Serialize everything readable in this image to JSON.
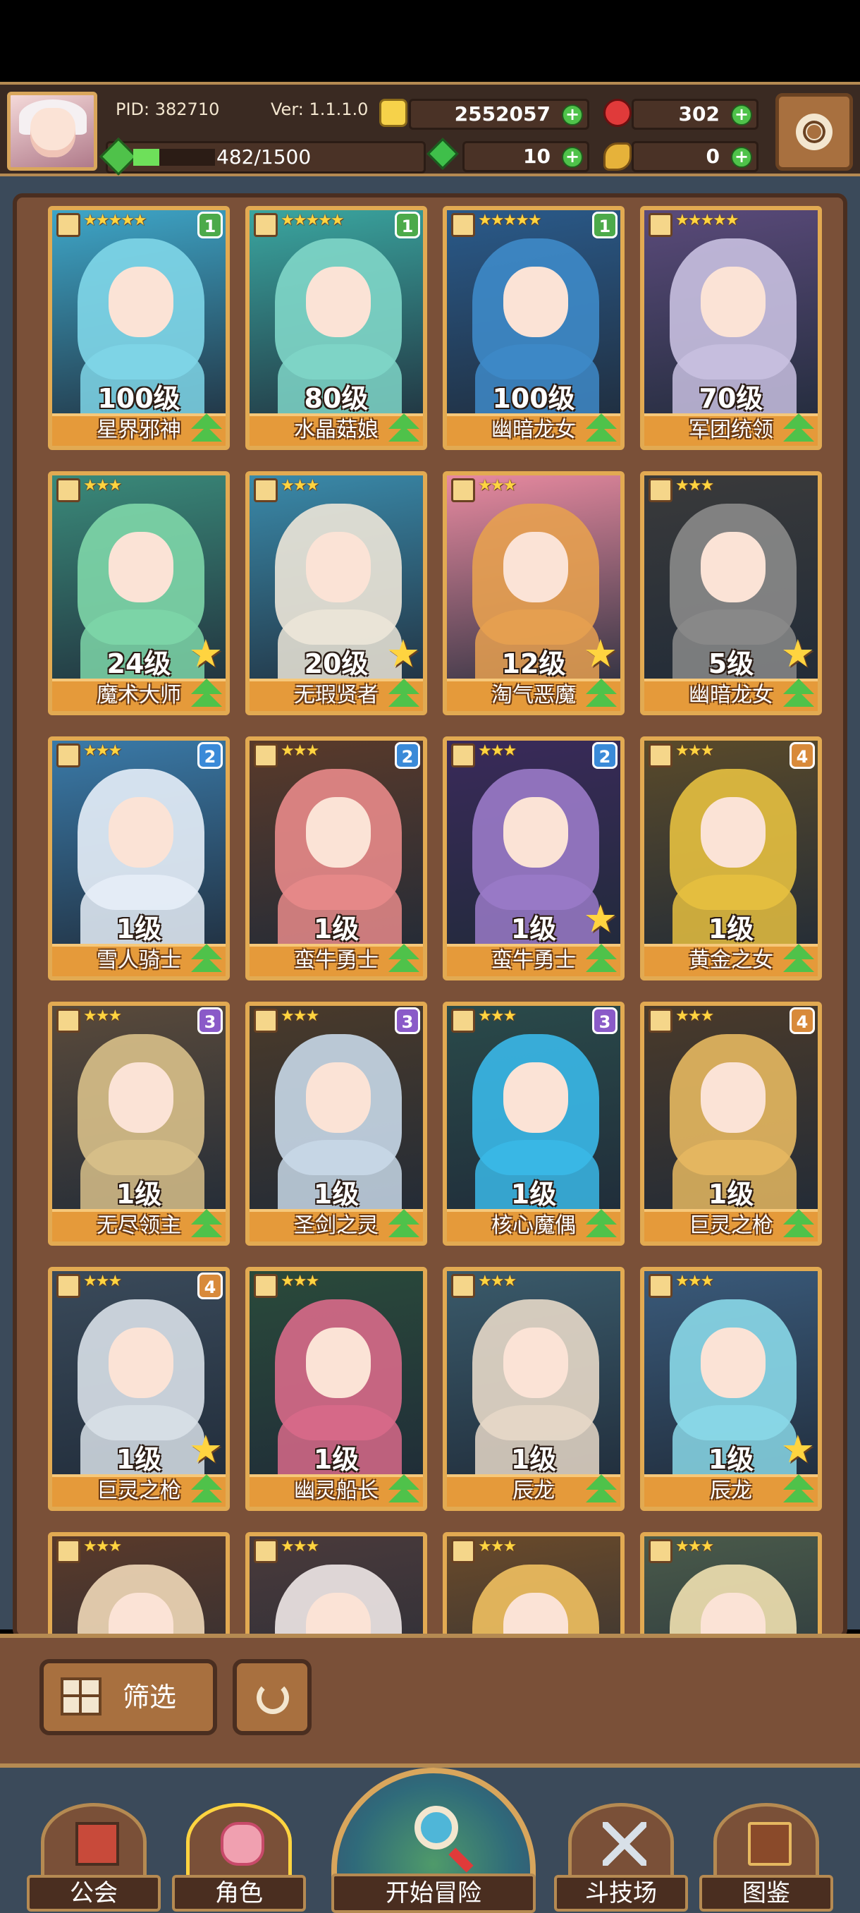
{
  "header": {
    "pid": "PID: 382710",
    "version": "Ver: 1.1.1.0",
    "gold": "2552057",
    "ruby": "302",
    "exp_text": "482/1500",
    "exp_progress": 0.32,
    "gems": "10",
    "coins": "0",
    "plus_label": "+"
  },
  "cards": [
    {
      "name": "星界邪神",
      "level": "100级",
      "stars": "★★★★★",
      "badge": "1",
      "badge_color": "#4caa4a",
      "colors": [
        "#3ea6c8",
        "#7fd6e8"
      ],
      "big_star": false
    },
    {
      "name": "水晶菇娘",
      "level": "80级",
      "stars": "★★★★★",
      "badge": "1",
      "badge_color": "#4caa4a",
      "colors": [
        "#3aa6a0",
        "#7fd6c8"
      ],
      "big_star": false
    },
    {
      "name": "幽暗龙女",
      "level": "100级",
      "stars": "★★★★★",
      "badge": "1",
      "badge_color": "#4caa4a",
      "colors": [
        "#2a5a8a",
        "#3e8ac8"
      ],
      "big_star": false
    },
    {
      "name": "军团统领",
      "level": "70级",
      "stars": "★★★★★",
      "badge": "",
      "badge_color": "",
      "colors": [
        "#5a4a7a",
        "#c8c0e0"
      ],
      "big_star": false
    },
    {
      "name": "魔术大师",
      "level": "24级",
      "stars": "★★★",
      "badge": "",
      "badge_color": "",
      "colors": [
        "#3a8a7a",
        "#7ed6a8"
      ],
      "big_star": true
    },
    {
      "name": "无瑕贤者",
      "level": "20级",
      "stars": "★★★",
      "badge": "",
      "badge_color": "",
      "colors": [
        "#3a8aaa",
        "#ece6d8"
      ],
      "big_star": true
    },
    {
      "name": "淘气恶魔",
      "level": "12级",
      "stars": "★★★",
      "badge": "",
      "badge_color": "",
      "colors": [
        "#e88aa0",
        "#e6a050"
      ],
      "big_star": true
    },
    {
      "name": "幽暗龙女",
      "level": "5级",
      "stars": "★★★",
      "badge": "",
      "badge_color": "",
      "colors": [
        "#3a3a3a",
        "#8a8a8a"
      ],
      "big_star": true
    },
    {
      "name": "雪人骑士",
      "level": "1级",
      "stars": "★★★",
      "badge": "2",
      "badge_color": "#3a8ad8",
      "colors": [
        "#3a7aa8",
        "#e6eef8"
      ],
      "big_star": false
    },
    {
      "name": "蛮牛勇士",
      "level": "1级",
      "stars": "★★★",
      "badge": "2",
      "badge_color": "#3a8ad8",
      "colors": [
        "#5a3a2a",
        "#e88a8a"
      ],
      "big_star": false
    },
    {
      "name": "蛮牛勇士",
      "level": "1级",
      "stars": "★★★",
      "badge": "2",
      "badge_color": "#3a8ad8",
      "colors": [
        "#3a2a5a",
        "#9a7ac8"
      ],
      "big_star": true
    },
    {
      "name": "黄金之女",
      "level": "1级",
      "stars": "★★★",
      "badge": "4",
      "badge_color": "#d88a3a",
      "colors": [
        "#5a4a2a",
        "#e6c040"
      ],
      "big_star": false
    },
    {
      "name": "无尽领主",
      "level": "1级",
      "stars": "★★★",
      "badge": "3",
      "badge_color": "#8a5ac8",
      "colors": [
        "#5a4a3a",
        "#d8c08a"
      ],
      "big_star": false
    },
    {
      "name": "圣剑之灵",
      "level": "1级",
      "stars": "★★★",
      "badge": "3",
      "badge_color": "#8a5ac8",
      "colors": [
        "#4a3a2a",
        "#c8d8e8"
      ],
      "big_star": false
    },
    {
      "name": "核心魔偶",
      "level": "1级",
      "stars": "★★★",
      "badge": "3",
      "badge_color": "#8a5ac8",
      "colors": [
        "#2a4a4a",
        "#3ab8e8"
      ],
      "big_star": false
    },
    {
      "name": "巨灵之枪",
      "level": "1级",
      "stars": "★★★",
      "badge": "4",
      "badge_color": "#d88a3a",
      "colors": [
        "#4a3a2a",
        "#e6b860"
      ],
      "big_star": false
    },
    {
      "name": "巨灵之枪",
      "level": "1级",
      "stars": "★★★",
      "badge": "4",
      "badge_color": "#d88a3a",
      "colors": [
        "#3a4a5a",
        "#d8e0e8"
      ],
      "big_star": true
    },
    {
      "name": "幽灵船长",
      "level": "1级",
      "stars": "★★★",
      "badge": "",
      "badge_color": "",
      "colors": [
        "#2a4a3a",
        "#d86a8a"
      ],
      "big_star": false
    },
    {
      "name": "辰龙",
      "level": "1级",
      "stars": "★★★",
      "badge": "",
      "badge_color": "",
      "colors": [
        "#3a5a6a",
        "#e6d8c8"
      ],
      "big_star": false
    },
    {
      "name": "辰龙",
      "level": "1级",
      "stars": "★★★",
      "badge": "",
      "badge_color": "",
      "colors": [
        "#3a5a7a",
        "#8ad8e8"
      ],
      "big_star": true
    },
    {
      "name": "",
      "level": "",
      "stars": "★★★",
      "badge": "",
      "badge_color": "",
      "colors": [
        "#5a3a2a",
        "#f0d8b8"
      ],
      "big_star": false
    },
    {
      "name": "",
      "level": "",
      "stars": "★★★",
      "badge": "",
      "badge_color": "",
      "colors": [
        "#4a3a3a",
        "#f0e8e8"
      ],
      "big_star": false
    },
    {
      "name": "",
      "level": "",
      "stars": "★★★",
      "badge": "",
      "badge_color": "",
      "colors": [
        "#6a4a2a",
        "#f0c060"
      ],
      "big_star": false
    },
    {
      "name": "",
      "level": "",
      "stars": "★★★",
      "badge": "",
      "badge_color": "",
      "colors": [
        "#4a5a4a",
        "#f0e0b0"
      ],
      "big_star": false
    }
  ],
  "filter": {
    "label": "筛选"
  },
  "nav": {
    "guild": "公会",
    "characters": "角色",
    "adventure": "开始冒险",
    "arena": "斗技场",
    "gallery": "图鉴"
  },
  "colors": {
    "frame": "#7a5038",
    "card_border": "#e2aa52",
    "name_bar": "#e59a3a",
    "upgrade": "#4fc24a"
  }
}
